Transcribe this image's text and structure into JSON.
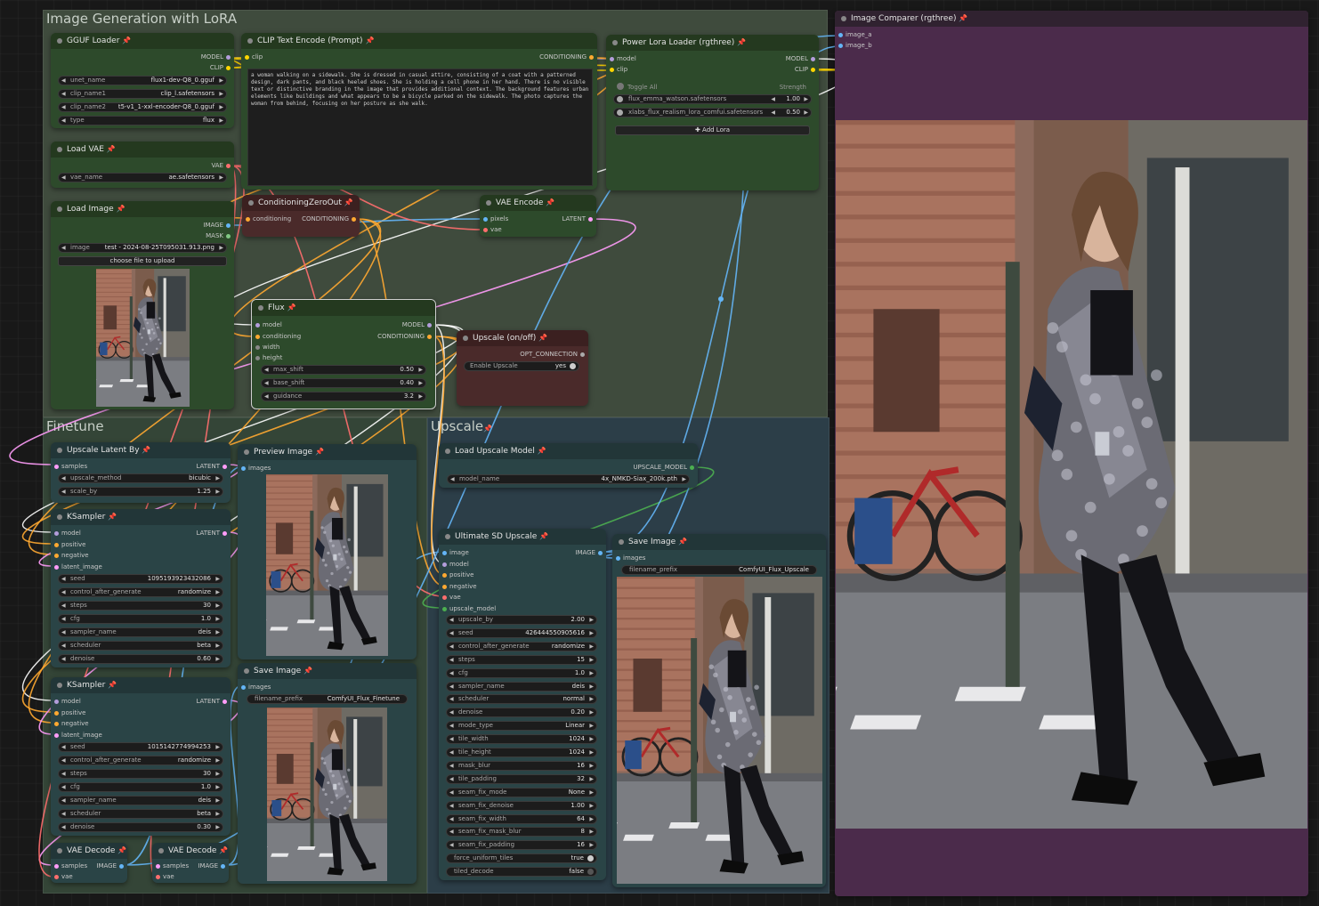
{
  "colors": {
    "model": "#b39ddb",
    "clip": "#ffd500",
    "conditioning": "#ffa931",
    "vae": "#ff6e6e",
    "latent": "#ff9cf9",
    "image": "#64b5f6",
    "mask": "#81c784",
    "upscale_model": "#4caf50",
    "opt": "#aaaaaa"
  },
  "groups": {
    "main": "Image Generation with LoRA",
    "finetune": "Finetune",
    "upscale": "Upscale"
  },
  "gguf": {
    "title": "GGUF Loader",
    "out_model": "MODEL",
    "out_clip": "CLIP",
    "widgets": [
      {
        "label": "unet_name",
        "value": "flux1-dev-Q8_0.gguf"
      },
      {
        "label": "clip_name1",
        "value": "clip_l.safetensors"
      },
      {
        "label": "clip_name2",
        "value": "t5-v1_1-xxl-encoder-Q8_0.gguf"
      },
      {
        "label": "type",
        "value": "flux"
      }
    ]
  },
  "vae_loader": {
    "title": "Load VAE",
    "out_vae": "VAE",
    "widget_label": "vae_name",
    "widget_value": "ae.safetensors"
  },
  "load_image": {
    "title": "Load Image",
    "out_image": "IMAGE",
    "out_mask": "MASK",
    "widget_label": "image",
    "widget_value": "test - 2024-08-25T095031.913.png",
    "upload_button": "choose file to upload"
  },
  "clip_encode": {
    "title": "CLIP Text Encode (Prompt)",
    "in_clip": "clip",
    "out_conditioning": "CONDITIONING",
    "prompt": "a woman walking on a sidewalk. She is dressed in casual attire, consisting of a coat with a patterned design, dark pants, and black heeled shoes. She is holding a cell phone in her hand. There is no visible text or distinctive branding in the image that provides additional context. The background features urban elements like buildings and what appears to be a bicycle parked on the sidewalk. The photo captures the woman from behind, focusing on her posture as she walk."
  },
  "lora": {
    "title": "Power Lora Loader (rgthree)",
    "in_model": "model",
    "in_clip": "clip",
    "out_model": "MODEL",
    "out_clip": "CLIP",
    "toggle_all": "Toggle All",
    "strength_label": "Strength",
    "loras": [
      {
        "name": "flux_emma_watson.safetensors",
        "strength": "1.00"
      },
      {
        "name": "xlabs_flux_realism_lora_comfui.safetensors",
        "strength": "0.50"
      }
    ],
    "add_button": "Add Lora"
  },
  "cond_zero": {
    "title": "ConditioningZeroOut",
    "in": "conditioning",
    "out": "CONDITIONING"
  },
  "vae_encode": {
    "title": "VAE Encode",
    "in_pixels": "pixels",
    "in_vae": "vae",
    "out": "LATENT"
  },
  "flux": {
    "title": "Flux",
    "inputs": [
      "model",
      "conditioning",
      "width",
      "height"
    ],
    "out_model": "MODEL",
    "out_conditioning": "CONDITIONING",
    "widgets": [
      {
        "label": "max_shift",
        "value": "0.50"
      },
      {
        "label": "base_shift",
        "value": "0.40"
      },
      {
        "label": "guidance",
        "value": "3.2"
      }
    ]
  },
  "upscale_switch": {
    "title": "Upscale (on/off)",
    "out": "OPT_CONNECTION",
    "widget_label": "Enable Upscale",
    "widget_value": "yes"
  },
  "upscale_latent": {
    "title": "Upscale Latent By",
    "in": "samples",
    "out": "LATENT",
    "widgets": [
      {
        "label": "upscale_method",
        "value": "bicubic"
      },
      {
        "label": "scale_by",
        "value": "1.25"
      }
    ]
  },
  "ksampler1": {
    "title": "KSampler",
    "inputs": [
      "model",
      "positive",
      "negative",
      "latent_image"
    ],
    "out": "LATENT",
    "widgets": [
      {
        "label": "seed",
        "value": "1095193923432086"
      },
      {
        "label": "control_after_generate",
        "value": "randomize"
      },
      {
        "label": "steps",
        "value": "30"
      },
      {
        "label": "cfg",
        "value": "1.0"
      },
      {
        "label": "sampler_name",
        "value": "deis"
      },
      {
        "label": "scheduler",
        "value": "beta"
      },
      {
        "label": "denoise",
        "value": "0.60"
      }
    ]
  },
  "ksampler2": {
    "title": "KSampler",
    "inputs": [
      "model",
      "positive",
      "negative",
      "latent_image"
    ],
    "out": "LATENT",
    "widgets": [
      {
        "label": "seed",
        "value": "1015142774994253"
      },
      {
        "label": "control_after_generate",
        "value": "randomize"
      },
      {
        "label": "steps",
        "value": "30"
      },
      {
        "label": "cfg",
        "value": "1.0"
      },
      {
        "label": "sampler_name",
        "value": "deis"
      },
      {
        "label": "scheduler",
        "value": "beta"
      },
      {
        "label": "denoise",
        "value": "0.30"
      }
    ]
  },
  "vae_decode1": {
    "title": "VAE Decode",
    "in_samples": "samples",
    "in_vae": "vae",
    "out": "IMAGE"
  },
  "vae_decode2": {
    "title": "VAE Decode",
    "in_samples": "samples",
    "in_vae": "vae",
    "out": "IMAGE"
  },
  "preview": {
    "title": "Preview Image",
    "in": "images"
  },
  "save_finetune": {
    "title": "Save Image",
    "in": "images",
    "widget_label": "filename_prefix",
    "widget_value": "ComfyUI_Flux_Finetune"
  },
  "load_upscale_model": {
    "title": "Load Upscale Model",
    "out": "UPSCALE_MODEL",
    "widget_label": "model_name",
    "widget_value": "4x_NMKD-Siax_200k.pth"
  },
  "ultimate": {
    "title": "Ultimate SD Upscale",
    "inputs": [
      "image",
      "model",
      "positive",
      "negative",
      "vae",
      "upscale_model"
    ],
    "out": "IMAGE",
    "widgets": [
      {
        "label": "upscale_by",
        "value": "2.00"
      },
      {
        "label": "seed",
        "value": "426444550905616"
      },
      {
        "label": "control_after_generate",
        "value": "randomize"
      },
      {
        "label": "steps",
        "value": "15"
      },
      {
        "label": "cfg",
        "value": "1.0"
      },
      {
        "label": "sampler_name",
        "value": "deis"
      },
      {
        "label": "scheduler",
        "value": "normal"
      },
      {
        "label": "denoise",
        "value": "0.20"
      },
      {
        "label": "mode_type",
        "value": "Linear"
      },
      {
        "label": "tile_width",
        "value": "1024"
      },
      {
        "label": "tile_height",
        "value": "1024"
      },
      {
        "label": "mask_blur",
        "value": "16"
      },
      {
        "label": "tile_padding",
        "value": "32"
      },
      {
        "label": "seam_fix_mode",
        "value": "None"
      },
      {
        "label": "seam_fix_denoise",
        "value": "1.00"
      },
      {
        "label": "seam_fix_width",
        "value": "64"
      },
      {
        "label": "seam_fix_mask_blur",
        "value": "8"
      },
      {
        "label": "seam_fix_padding",
        "value": "16"
      }
    ],
    "toggles": [
      {
        "label": "force_uniform_tiles",
        "value": "true"
      },
      {
        "label": "tiled_decode",
        "value": "false"
      }
    ]
  },
  "save_upscale": {
    "title": "Save Image",
    "in": "images",
    "widget_label": "filename_prefix",
    "widget_value": "ComfyUI_Flux_Upscale"
  },
  "comparer": {
    "title": "Image Comparer (rgthree)",
    "in_a": "image_a",
    "in_b": "image_b"
  }
}
